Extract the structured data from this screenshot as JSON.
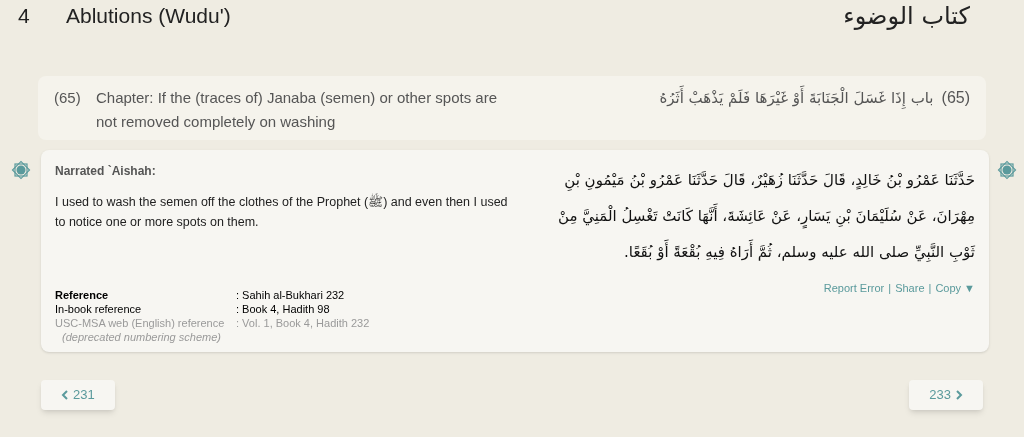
{
  "book": {
    "number": "4",
    "title": "Ablutions (Wudu')",
    "arabic_title": "كتاب الوضوء"
  },
  "chapter": {
    "number": "(65)",
    "title": "Chapter: If the (traces of) Janaba (semen) or other spots are not removed completely on washing",
    "arabic_number": "(65)",
    "arabic_title": "باب إِذَا غَسَلَ الْجَنَابَةَ أَوْ غَيْرَهَا فَلَمْ يَذْهَبْ أَثَرُهُ"
  },
  "hadith": {
    "narrator": "Narrated `Aishah:",
    "text": "I used to wash the semen off the clothes of the Prophet (ﷺ) and even then I used to notice one or more spots on them.",
    "arabic": "حَدَّثَنَا عَمْرُو بْنُ خَالِدٍ، قَالَ حَدَّثَنَا زُهَيْرٌ، قَالَ حَدَّثَنَا عَمْرُو بْنُ مَيْمُونِ بْنِ مِهْرَانَ، عَنْ سُلَيْمَانَ بْنِ يَسَارٍ، عَنْ عَائِشَةَ، أَنَّهَا كَانَتْ تَغْسِلُ الْمَنِيَّ مِنْ ثَوْبِ النَّبِيِّ صلى الله عليه وسلم، ثُمَّ أَرَاهُ فِيهِ بُقْعَةً أَوْ بُقَعًا.",
    "references": [
      {
        "kind": "main",
        "label": "Reference",
        "value": ": Sahih al-Bukhari 232"
      },
      {
        "kind": "normal",
        "label": "In-book reference",
        "value": ": Book 4, Hadith 98"
      },
      {
        "kind": "deprecated",
        "label": "USC-MSA web (English) reference",
        "value": ": Vol. 1, Book 4, Hadith 232",
        "note": "(deprecated numbering scheme)"
      }
    ],
    "actions": [
      "Report Error",
      "|",
      "Share",
      "|",
      "Copy ▼"
    ]
  },
  "nav": {
    "previous": "231",
    "next": "233"
  }
}
